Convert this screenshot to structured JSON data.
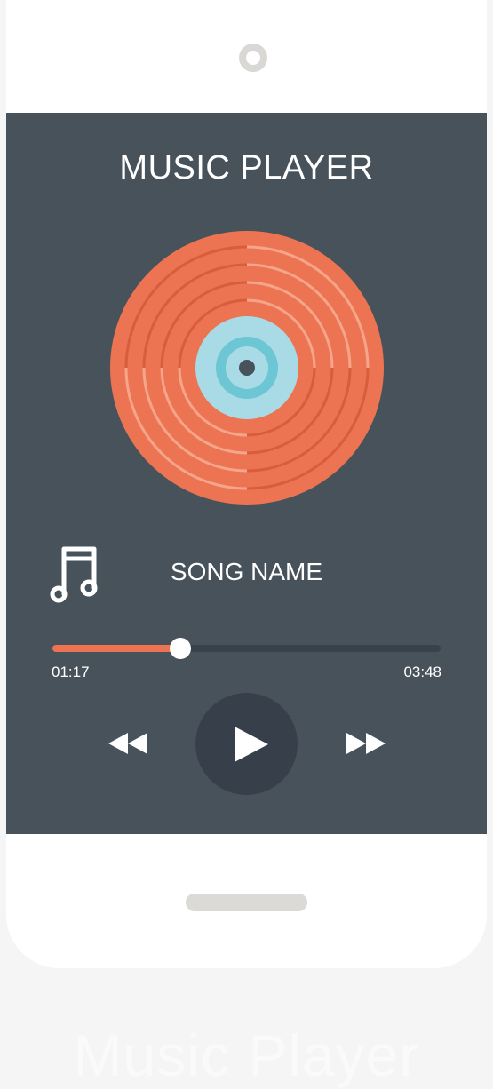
{
  "app": {
    "title": "MUSIC PLAYER",
    "watermark": "Music Player"
  },
  "now_playing": {
    "song_name": "SONG NAME",
    "elapsed": "01:17",
    "total": "03:48",
    "progress": 0.33
  },
  "controls": {
    "rewind_icon": "rewind-icon",
    "play_icon": "play-icon",
    "forward_icon": "fast-forward-icon"
  },
  "colors": {
    "screen": "#47525b",
    "record": "#ec7453",
    "record_label": "#a8dbe5",
    "accent": "#ec7453"
  }
}
